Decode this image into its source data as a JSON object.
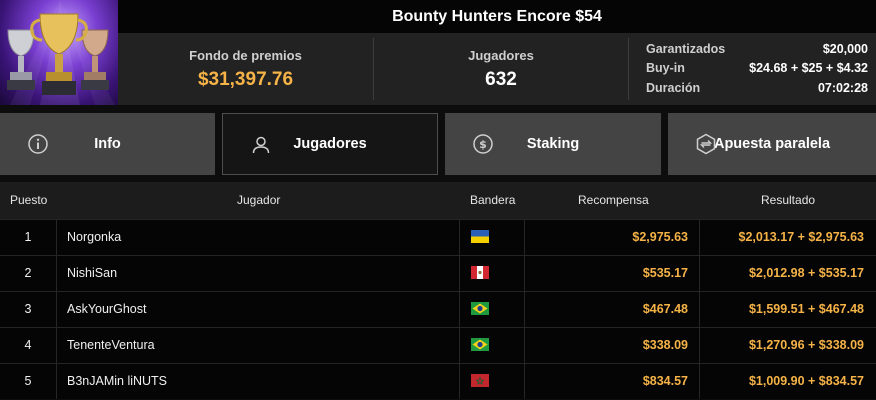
{
  "tournament": {
    "title": "Bounty Hunters Encore $54",
    "prize_pool_label": "Fondo de premios",
    "prize_pool_value": "$31,397.76",
    "players_label": "Jugadores",
    "players_value": "632",
    "details": [
      {
        "label": "Garantizados",
        "value": "$20,000"
      },
      {
        "label": "Buy-in",
        "value": "$24.68 + $25 + $4.32"
      },
      {
        "label": "Duración",
        "value": "07:02:28"
      }
    ]
  },
  "tabs": [
    {
      "label": "Info",
      "icon": "info-icon",
      "active": false
    },
    {
      "label": "Jugadores",
      "icon": "user-icon",
      "active": true
    },
    {
      "label": "Staking",
      "icon": "dollar-coin-icon",
      "active": false
    },
    {
      "label": "Apuesta paralela",
      "icon": "side-bet-icon",
      "active": false
    }
  ],
  "table": {
    "headers": {
      "position": "Puesto",
      "player": "Jugador",
      "flag": "Bandera",
      "reward": "Recompensa",
      "result": "Resultado"
    },
    "rows": [
      {
        "position": "1",
        "player": "Norgonka",
        "flag": "ukraine-flag",
        "reward": "$2,975.63",
        "result": "$2,013.17 + $2,975.63"
      },
      {
        "position": "2",
        "player": "NishiSan",
        "flag": "peru-flag",
        "reward": "$535.17",
        "result": "$2,012.98 + $535.17"
      },
      {
        "position": "3",
        "player": "AskYourGhost",
        "flag": "brazil-flag",
        "reward": "$467.48",
        "result": "$1,599.51 + $467.48"
      },
      {
        "position": "4",
        "player": "TenenteVentura",
        "flag": "brazil-flag",
        "reward": "$338.09",
        "result": "$1,270.96 + $338.09"
      },
      {
        "position": "5",
        "player": "B3nJAMin liNUTS",
        "flag": "morocco-flag",
        "reward": "$834.57",
        "result": "$1,009.90 + $834.57"
      }
    ]
  },
  "colors": {
    "accent_gold": "#f6b347",
    "tab_bg": "#444444",
    "tab_active_bg": "#151515",
    "row_bg": "#050505"
  }
}
